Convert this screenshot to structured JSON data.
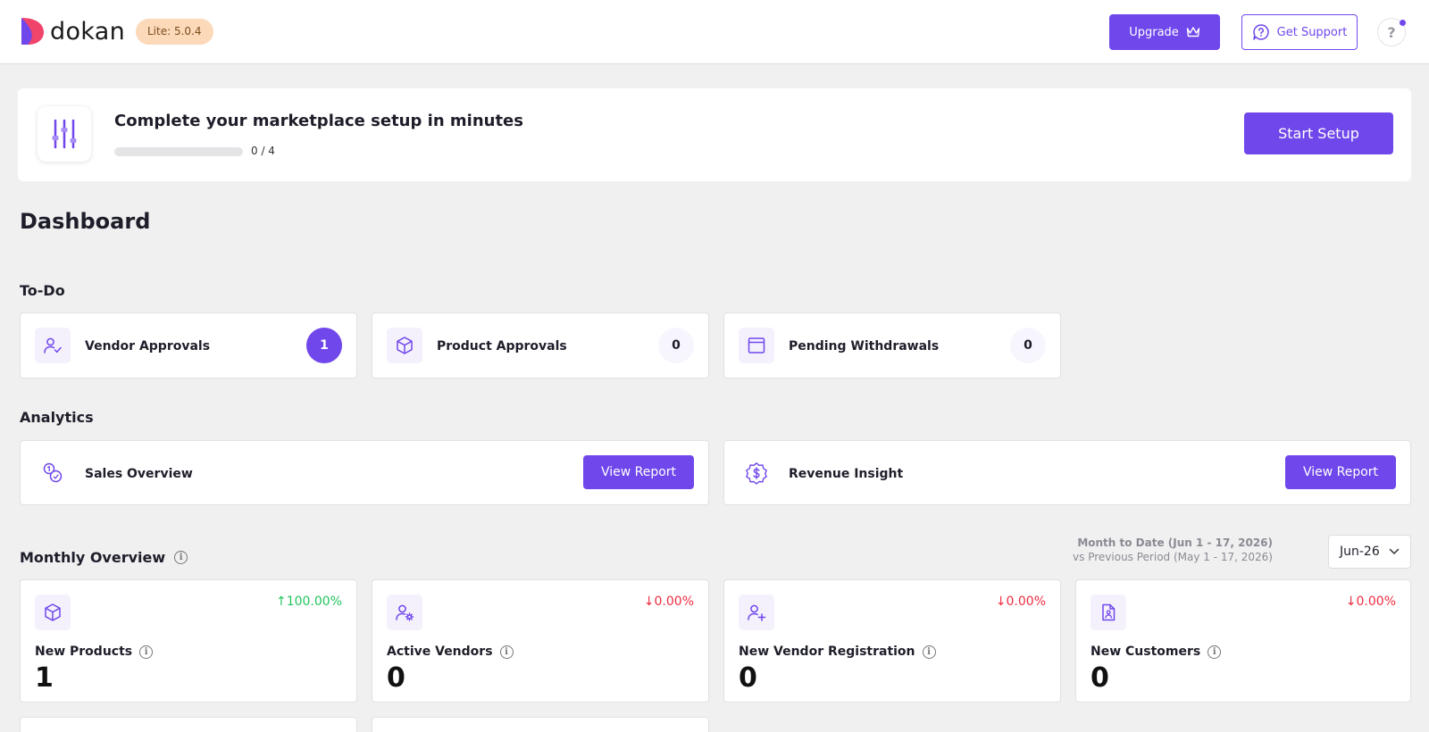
{
  "header": {
    "brand": "dokan",
    "version_badge": "Lite: 5.0.4",
    "upgrade_label": "Upgrade",
    "support_label": "Get Support",
    "help_label": "?"
  },
  "setup": {
    "title": "Complete your marketplace setup in minutes",
    "progress_text": "0 / 4",
    "progress_fraction": 0,
    "start_label": "Start Setup"
  },
  "page_title": "Dashboard",
  "todo": {
    "title": "To-Do",
    "items": [
      {
        "label": "Vendor Approvals",
        "count": "1"
      },
      {
        "label": "Product Approvals",
        "count": "0"
      },
      {
        "label": "Pending Withdrawals",
        "count": "0"
      }
    ]
  },
  "analytics": {
    "title": "Analytics",
    "items": [
      {
        "label": "Sales Overview",
        "button": "View Report"
      },
      {
        "label": "Revenue Insight",
        "button": "View Report"
      }
    ]
  },
  "monthly": {
    "title": "Monthly Overview",
    "period_current": "Month to Date (Jun 1 - 17, 2026)",
    "period_previous": "vs Previous Period (May 1 - 17, 2026)",
    "selected_month": "Jun-26",
    "stats": [
      {
        "label": "New Products",
        "value": "1",
        "change": "100.00%",
        "direction": "up"
      },
      {
        "label": "Active Vendors",
        "value": "0",
        "change": "0.00%",
        "direction": "down"
      },
      {
        "label": "New Vendor Registration",
        "value": "0",
        "change": "0.00%",
        "direction": "down"
      },
      {
        "label": "New Customers",
        "value": "0",
        "change": "0.00%",
        "direction": "down"
      }
    ]
  },
  "colors": {
    "accent": "#7047eb",
    "up": "#22c55e",
    "down": "#ef2b3f"
  }
}
